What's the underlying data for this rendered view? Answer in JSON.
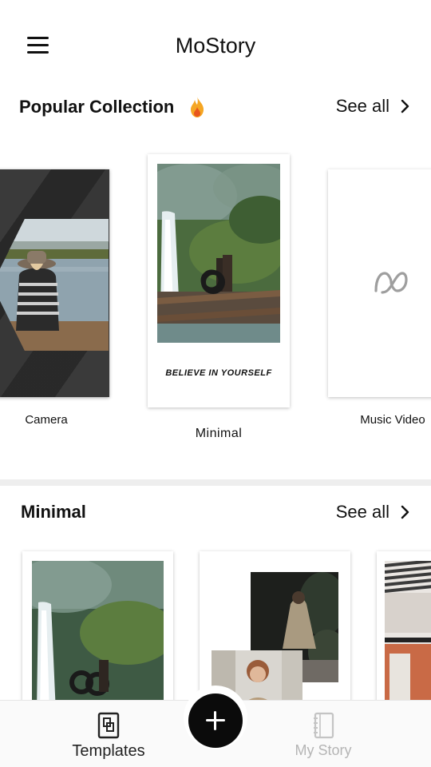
{
  "app": {
    "title": "MoStory"
  },
  "popular": {
    "title": "Popular Collection",
    "see_all": "See all",
    "cards": [
      {
        "label": "Camera"
      },
      {
        "label": "Minimal",
        "caption": "BELIEVE IN YOURSELF"
      },
      {
        "label": "Music Video"
      }
    ]
  },
  "minimal_section": {
    "title": "Minimal",
    "see_all": "See all"
  },
  "bottom_nav": {
    "templates_label": "Templates",
    "my_story_label": "My Story"
  },
  "icons": {
    "menu": "hamburger-icon",
    "fire": "fire-icon",
    "chevron": "chevron-right-icon",
    "add": "plus-icon",
    "templates": "templates-icon",
    "my_story": "notebook-icon",
    "music_video": "infinity-logo-icon"
  },
  "colors": {
    "fab": "#0b0b0b",
    "fire": "#f5a623",
    "inactive_nav": "#b5b5b5"
  }
}
